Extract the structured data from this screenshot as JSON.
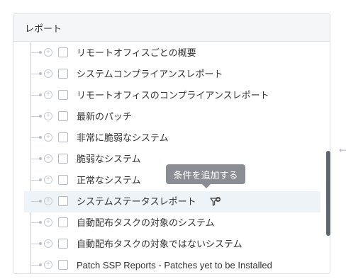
{
  "panel": {
    "title": "レポート",
    "items": [
      {
        "label": "リモートオフィスごとの概要"
      },
      {
        "label": "システムコンプライアンスレポート"
      },
      {
        "label": "リモートオフィスのコンプライアンスレポート"
      },
      {
        "label": "最新のパッチ"
      },
      {
        "label": "非常に脆弱なシステム"
      },
      {
        "label": "脆弱なシステム"
      },
      {
        "label": "正常なシステム"
      },
      {
        "label": "システムステータスレポート",
        "highlighted": true,
        "icon": "filter-add-icon"
      },
      {
        "label": "自動配布タスクの対象のシステム"
      },
      {
        "label": "自動配布タスクの対象ではないシステム"
      },
      {
        "label": "Patch SSP Reports - Patches yet to be Installed"
      }
    ]
  },
  "tooltip": {
    "text": "条件を追加する"
  },
  "colors": {
    "header_bg": "#f5f6f8",
    "highlight_bg": "#eef3f8",
    "tooltip_bg": "#8a8e94",
    "scrollbar": "#5f6670"
  }
}
